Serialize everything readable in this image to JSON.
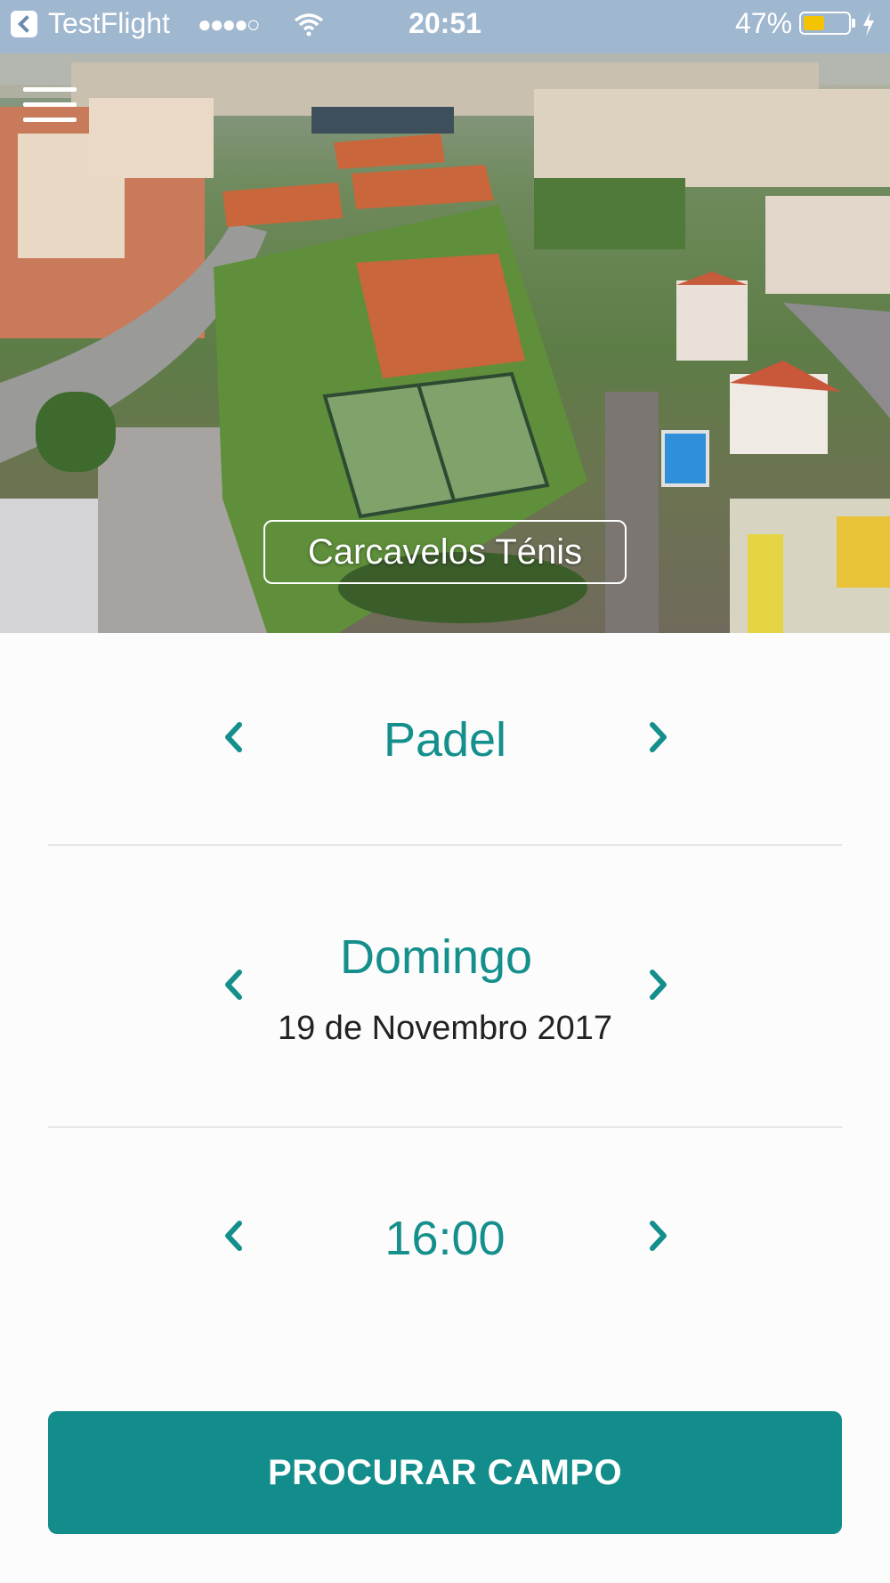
{
  "status_bar": {
    "carrier": "TestFlight",
    "signal": "●●●●○",
    "time": "20:51",
    "battery_percent": "47%",
    "battery_level": 0.47
  },
  "hero": {
    "venue_name": "Carcavelos Ténis",
    "menu_icon": "hamburger-menu-icon"
  },
  "sport": {
    "value": "Padel"
  },
  "date": {
    "weekday": "Domingo",
    "full_date": "19 de Novembro 2017"
  },
  "time_slot": {
    "value": "16:00"
  },
  "actions": {
    "search_label": "PROCURAR CAMPO"
  },
  "colors": {
    "accent": "#148f8c",
    "button": "#138d8b",
    "battery": "#f5c400"
  }
}
